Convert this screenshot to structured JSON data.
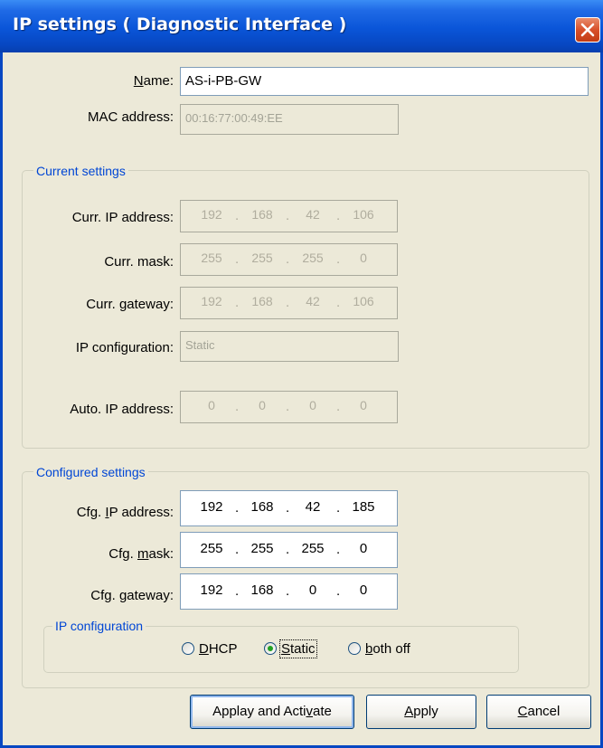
{
  "window": {
    "title": "IP settings ( Diagnostic Interface )"
  },
  "name_field": {
    "label": "Name:",
    "value": "AS-i-PB-GW"
  },
  "mac_field": {
    "label": "MAC address:",
    "value": "00:16:77:00:49:EE"
  },
  "current_settings": {
    "title": "Current settings",
    "ip": {
      "label": "Curr. IP address:",
      "octets": [
        "192",
        "168",
        "42",
        "106"
      ]
    },
    "mask": {
      "label": "Curr. mask:",
      "octets": [
        "255",
        "255",
        "255",
        "0"
      ]
    },
    "gateway": {
      "label": "Curr. gateway:",
      "octets": [
        "192",
        "168",
        "42",
        "106"
      ]
    },
    "ip_config": {
      "label": "IP configuration:",
      "value": "Static"
    },
    "auto_ip": {
      "label": "Auto. IP address:",
      "octets": [
        "0",
        "0",
        "0",
        "0"
      ]
    }
  },
  "configured_settings": {
    "title": "Configured settings",
    "ip": {
      "label_pre": "Cfg. ",
      "label_u": "I",
      "label_post": "P address:",
      "octets": [
        "192",
        "168",
        "42",
        "185"
      ]
    },
    "mask": {
      "label_pre": "Cfg. ",
      "label_u": "m",
      "label_post": "ask:",
      "octets": [
        "255",
        "255",
        "255",
        "0"
      ]
    },
    "gateway": {
      "label_pre": "Cfg. ",
      "label_u": "g",
      "label_post": "ateway:",
      "octets": [
        "192",
        "168",
        "0",
        "0"
      ]
    },
    "ip_config": {
      "title": "IP configuration",
      "options": [
        {
          "u": "D",
          "rest": "HCP",
          "checked": false
        },
        {
          "u": "S",
          "rest": "tatic",
          "checked": true
        },
        {
          "u": "b",
          "rest": "oth off",
          "checked": false
        }
      ]
    }
  },
  "buttons": {
    "apply_activate": {
      "pre": "Applay and Acti",
      "u": "v",
      "post": "ate"
    },
    "apply": {
      "u": "A",
      "post": "pply"
    },
    "cancel": {
      "u": "C",
      "post": "ancel"
    }
  },
  "icons": {
    "close": "close-x-icon"
  },
  "colors": {
    "titlebar": "#0a55d8",
    "group_title": "#0046d5",
    "close": "#d8502a",
    "radio_checked": "#21a121"
  }
}
